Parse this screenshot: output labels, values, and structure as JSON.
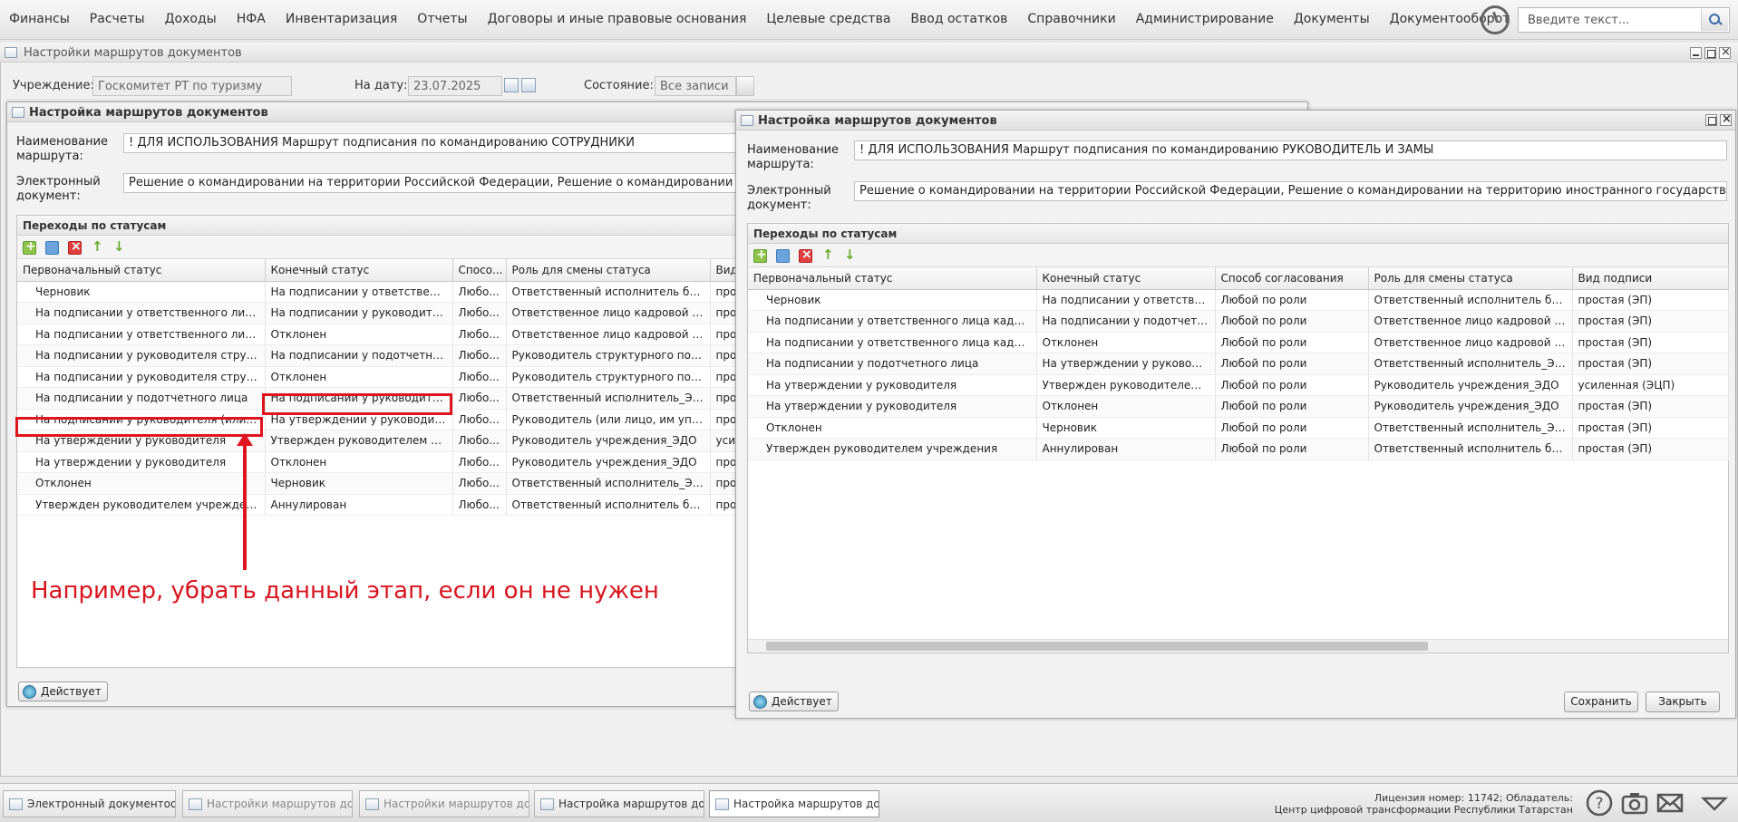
{
  "menu": [
    "Финансы",
    "Расчеты",
    "Доходы",
    "НФА",
    "Инвентаризация",
    "Отчеты",
    "Договоры и иные правовые основания",
    "Целевые средства",
    "Ввод остатков",
    "Справочники",
    "Администрирование",
    "Документы",
    "Документооборот"
  ],
  "search": {
    "placeholder": "Введите текст..."
  },
  "outer": {
    "title": "Настройки маршрутов документов",
    "org_label": "Учреждение:",
    "org_value": "Госкомитет РТ по туризму",
    "date_label": "На дату:",
    "date_value": "23.07.2025",
    "state_label": "Состояние:",
    "state_value": "Все записи"
  },
  "left": {
    "title": "Настройка маршрутов документов",
    "name_label": "Наименование маршрута:",
    "name_value": "! ДЛЯ ИСПОЛЬЗОВАНИЯ Маршрут подписания по командированию СОТРУДНИКИ",
    "doc_label": "Электронный документ:",
    "doc_value": "Решение о командировании на территории Российской Федерации, Решение о командировании на террито",
    "panel_title": "Переходы по статусам",
    "columns": [
      "Первоначальный статус",
      "Конечный статус",
      "Спосо...",
      "Роль для смены статуса",
      "Вид"
    ],
    "rows": [
      [
        "Черновик",
        "На подписании у ответственног...",
        "Любо...",
        "Ответственный исполнитель бухга...",
        "про"
      ],
      [
        "На подписании у ответственного лица ка...",
        "На подписании у руководителя ...",
        "Любо...",
        "Ответственное лицо кадровой слу...",
        "про"
      ],
      [
        "На подписании у ответственного лица ка...",
        "Отклонен",
        "Любо...",
        "Ответственное лицо кадровой слу...",
        "про"
      ],
      [
        "На подписании у руководителя структур...",
        "На подписании у подотчетного ...",
        "Любо...",
        "Руководитель структурного подраз...",
        "про"
      ],
      [
        "На подписании у руководителя структур...",
        "Отклонен",
        "Любо...",
        "Руководитель структурного подраз...",
        "про"
      ],
      [
        "На подписании у подотчетного лица",
        "На подписании у руководителя ...",
        "Любо...",
        "Ответственный исполнитель_ЭДО",
        "про"
      ],
      [
        "На подписании у руководителя (или лиц...",
        "На утверждении у руководителя",
        "Любо...",
        "Руководитель (или лицо, им уполн...",
        "про"
      ],
      [
        "На утверждении у руководителя",
        "Утвержден руководителем учре...",
        "Любо...",
        "Руководитель учреждения_ЭДО",
        "уси"
      ],
      [
        "На утверждении у руководителя",
        "Отклонен",
        "Любо...",
        "Руководитель учреждения_ЭДО",
        "про"
      ],
      [
        "Отклонен",
        "Черновик",
        "Любо...",
        "Ответственный исполнитель_ЭДО",
        "про"
      ],
      [
        "Утвержден руководителем учреждения",
        "Аннулирован",
        "Любо...",
        "Ответственный исполнитель бухга...",
        "про"
      ]
    ],
    "status_button": "Действует"
  },
  "annotation": "Например, убрать данный этап, если он не нужен",
  "right": {
    "title": "Настройка маршрутов документов",
    "name_label": "Наименование маршрута:",
    "name_value": "! ДЛЯ ИСПОЛЬЗОВАНИЯ Маршрут подписания по командированию  РУКОВОДИТЕЛЬ И ЗАМЫ",
    "doc_label": "Электронный документ:",
    "doc_value": "Решение о командировании на территории Российской Федерации, Решение о командировании на территорию иностранного государства, Изменение Р",
    "panel_title": "Переходы по статусам",
    "columns": [
      "Первоначальный статус",
      "Конечный статус",
      "Способ согласования",
      "Роль для смены статуса",
      "Вид подписи"
    ],
    "rows": [
      [
        "Черновик",
        "На подписании у ответственн...",
        "Любой по роли",
        "Ответственный исполнитель бухга...",
        "простая (ЭП)"
      ],
      [
        "На подписании у ответственного лица кадровой ...",
        "На подписании у подотчетног...",
        "Любой по роли",
        "Ответственное лицо кадровой слу...",
        "простая (ЭП)"
      ],
      [
        "На подписании у ответственного лица кадровой ...",
        "Отклонен",
        "Любой по роли",
        "Ответственное лицо кадровой слу...",
        "простая (ЭП)"
      ],
      [
        "На подписании у подотчетного лица",
        "На утверждении у руководите...",
        "Любой по роли",
        "Ответственный исполнитель_ЭДО",
        "простая (ЭП)"
      ],
      [
        "На утверждении у руководителя",
        "Утвержден руководителем уч...",
        "Любой по роли",
        "Руководитель учреждения_ЭДО",
        "усиленная (ЭЦП)"
      ],
      [
        "На утверждении у руководителя",
        "Отклонен",
        "Любой по роли",
        "Руководитель учреждения_ЭДО",
        "простая (ЭП)"
      ],
      [
        "Отклонен",
        "Черновик",
        "Любой по роли",
        "Ответственный исполнитель_ЭДО",
        "простая (ЭП)"
      ],
      [
        "Утвержден руководителем учреждения",
        "Аннулирован",
        "Любой по роли",
        "Ответственный исполнитель бухга...",
        "простая (ЭП)"
      ]
    ],
    "status_button": "Действует",
    "save_button": "Сохранить",
    "close_button": "Закрыть"
  },
  "taskbar": [
    "Электронный документоо...",
    "Настройки маршрутов до...",
    "Настройки маршрутов до...",
    "Настройка маршрутов до...",
    "Настройка маршрутов до..."
  ],
  "license": {
    "line1": "Лицензия номер: 11742; Обладатель:",
    "line2": "Центр цифровой трансформации Республики Татарстан"
  },
  "icons": [
    "clock-icon",
    "search-icon",
    "help-icon",
    "camera-icon",
    "mail-icon",
    "chevron-down-icon"
  ]
}
